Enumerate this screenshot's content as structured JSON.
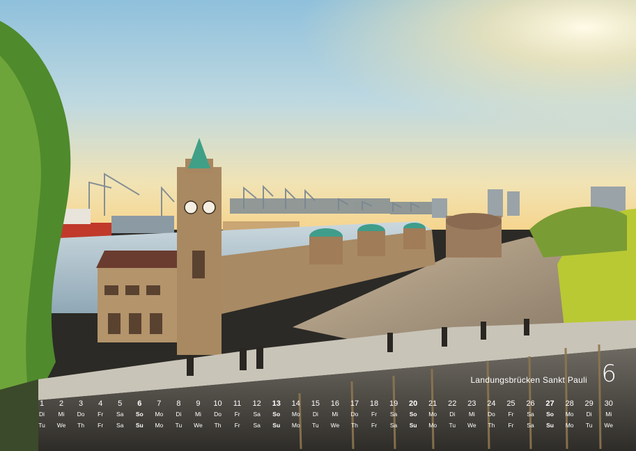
{
  "caption": "Landungsbrücken Sankt Pauli",
  "month_number": "6",
  "calendar": [
    {
      "day": "1",
      "de": "Di",
      "en": "Tu"
    },
    {
      "day": "2",
      "de": "Mi",
      "en": "We"
    },
    {
      "day": "3",
      "de": "Do",
      "en": "Th"
    },
    {
      "day": "4",
      "de": "Fr",
      "en": "Fr"
    },
    {
      "day": "5",
      "de": "Sa",
      "en": "Sa"
    },
    {
      "day": "6",
      "de": "So",
      "en": "Su",
      "weekend": true
    },
    {
      "day": "7",
      "de": "Mo",
      "en": "Mo"
    },
    {
      "day": "8",
      "de": "Di",
      "en": "Tu"
    },
    {
      "day": "9",
      "de": "Mi",
      "en": "We"
    },
    {
      "day": "10",
      "de": "Do",
      "en": "Th"
    },
    {
      "day": "11",
      "de": "Fr",
      "en": "Fr"
    },
    {
      "day": "12",
      "de": "Sa",
      "en": "Sa"
    },
    {
      "day": "13",
      "de": "So",
      "en": "Su",
      "weekend": true
    },
    {
      "day": "14",
      "de": "Mo",
      "en": "Mo"
    },
    {
      "day": "15",
      "de": "Di",
      "en": "Tu"
    },
    {
      "day": "16",
      "de": "Mi",
      "en": "We"
    },
    {
      "day": "17",
      "de": "Do",
      "en": "Th"
    },
    {
      "day": "18",
      "de": "Fr",
      "en": "Fr"
    },
    {
      "day": "19",
      "de": "Sa",
      "en": "Sa"
    },
    {
      "day": "20",
      "de": "So",
      "en": "Su",
      "weekend": true
    },
    {
      "day": "21",
      "de": "Mo",
      "en": "Mo"
    },
    {
      "day": "22",
      "de": "Di",
      "en": "Tu"
    },
    {
      "day": "23",
      "de": "Mi",
      "en": "We"
    },
    {
      "day": "24",
      "de": "Do",
      "en": "Th"
    },
    {
      "day": "25",
      "de": "Fr",
      "en": "Fr"
    },
    {
      "day": "26",
      "de": "Sa",
      "en": "Sa"
    },
    {
      "day": "27",
      "de": "So",
      "en": "Su",
      "weekend": true
    },
    {
      "day": "28",
      "de": "Mo",
      "en": "Mo"
    },
    {
      "day": "29",
      "de": "Di",
      "en": "Tu"
    },
    {
      "day": "30",
      "de": "Mi",
      "en": "We"
    }
  ]
}
